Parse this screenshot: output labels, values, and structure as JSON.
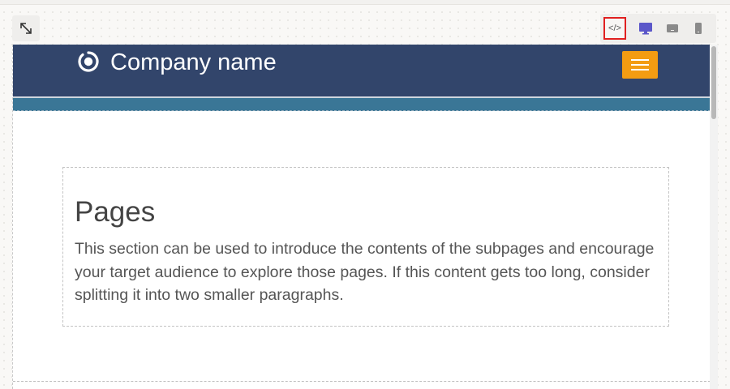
{
  "editor": {
    "expand_icon": "expand-arrows-icon",
    "devices": [
      {
        "name": "code-view",
        "icon": "code-icon",
        "label": "</>"
      },
      {
        "name": "desktop-view",
        "icon": "monitor-icon"
      },
      {
        "name": "tablet-view",
        "icon": "tablet-icon"
      },
      {
        "name": "mobile-view",
        "icon": "phone-icon"
      }
    ],
    "accent_color": "#5b57c9",
    "highlight_color": "#e02020"
  },
  "site": {
    "company_name": "Company name",
    "logo_icon": "ring-logo-icon",
    "menu_icon": "hamburger-icon",
    "header_color": "#32456b",
    "band_color": "#3a7696",
    "menu_color": "#f39c12"
  },
  "section": {
    "title": "Pages",
    "text": "This section can be used to introduce the contents of the subpages and encourage your target audience to explore those pages. If this content gets too long, consider splitting it into two smaller paragraphs."
  }
}
